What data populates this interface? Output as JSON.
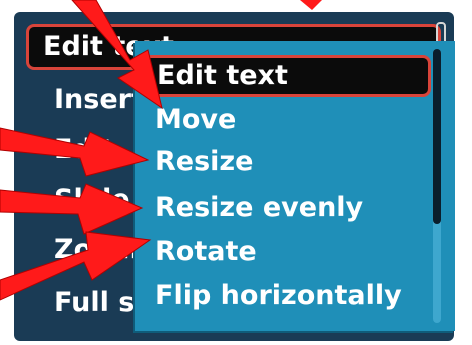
{
  "main_menu": {
    "items": [
      {
        "label": "Edit text"
      },
      {
        "label": "Insert"
      },
      {
        "label": "Edit"
      },
      {
        "label": "Slide"
      },
      {
        "label": "Zoom"
      },
      {
        "label": "Full screen"
      }
    ],
    "selected_arrow": "›"
  },
  "submenu": {
    "items": [
      {
        "label": "Edit text"
      },
      {
        "label": "Move"
      },
      {
        "label": "Resize"
      },
      {
        "label": "Resize evenly"
      },
      {
        "label": "Rotate"
      },
      {
        "label": "Flip horizontally"
      }
    ],
    "selected_index": 0,
    "scroll_fraction_visible": 0.64
  },
  "annotation": {
    "arrow_color": "#ff1a1a"
  }
}
